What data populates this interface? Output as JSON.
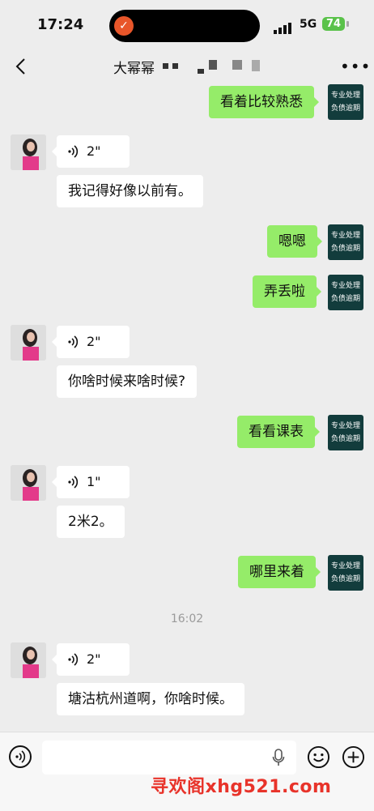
{
  "status_bar": {
    "time": "17:24",
    "network": "5G",
    "battery": "74"
  },
  "nav": {
    "title": "大幂幂"
  },
  "biz_avatar": {
    "line1": "专业处理",
    "line2": "负债逾期"
  },
  "messages": {
    "m1": "看着比较熟悉",
    "m2_voice": "2\"",
    "m3": "我记得好像以前有。",
    "m4": "嗯嗯",
    "m5": "弄丢啦",
    "m6_voice": "2\"",
    "m7": "你啥时候来啥时候?",
    "m8": "看看课表",
    "m9_voice": "1\"",
    "m10": "2米2。",
    "m11": "哪里来着",
    "timestamp": "16:02",
    "m12_voice": "2\"",
    "m13": "塘沽杭州道啊，你啥时候。"
  },
  "input": {
    "placeholder": ""
  },
  "watermark": "寻欢阁xhg521.com",
  "colors": {
    "sent_bubble": "#95ec69",
    "received_bubble": "#ffffff",
    "background": "#ededed"
  }
}
